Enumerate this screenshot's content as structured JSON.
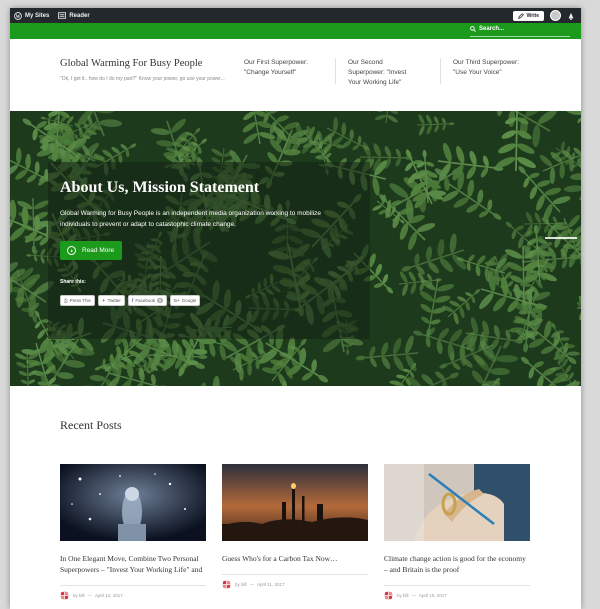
{
  "admin_bar": {
    "my_sites": "My Sites",
    "reader": "Reader",
    "write": "Write"
  },
  "search": {
    "label": "Search..."
  },
  "header": {
    "site_title": "Global Warming For Busy People",
    "tagline": "\"Ok, I get it.. how do I do my part?\" Know your power, go use your power...",
    "nav": [
      {
        "line1": "Our First Superpower:",
        "line2": "\"Change Yourself\""
      },
      {
        "line1": "Our Second",
        "line2": "Superpower: \"Invest",
        "line3": "Your Working Life\""
      },
      {
        "line1": "Our Third Superpower:",
        "line2": "\"Use Your Voice\""
      }
    ]
  },
  "hero": {
    "title": "About Us, Mission Statement",
    "text": "Global Warming for Busy People is an independent media organization working to mobilize individuals to prevent or adapt to catastophic climate change.",
    "read_more": "Read More",
    "share_label": "Share this:",
    "share_buttons": [
      {
        "icon": "print-icon",
        "label": "Press This"
      },
      {
        "icon": "twitter-icon",
        "label": "Twitter"
      },
      {
        "icon": "facebook-icon",
        "label": "Facebook"
      },
      {
        "icon": "google-plus-icon",
        "label": "Google"
      }
    ],
    "facebook_count": "0"
  },
  "recent": {
    "title": "Recent Posts",
    "posts": [
      {
        "title": "In One Elegant Move, Combine Two Personal Superpowers – \"Invest Your Working Life\" and",
        "author": "by bill",
        "date": "April 12, 2017"
      },
      {
        "title": "Guess Who's for a Carbon Tax Now…",
        "author": "by bill",
        "date": "April 11, 2017"
      },
      {
        "title": "Climate change action is good for the economy – and Britain is the proof",
        "author": "by bill",
        "date": "April 10, 2017"
      }
    ]
  },
  "colors": {
    "accent_green": "#1c9a1c",
    "admin_bar": "#23282d"
  }
}
